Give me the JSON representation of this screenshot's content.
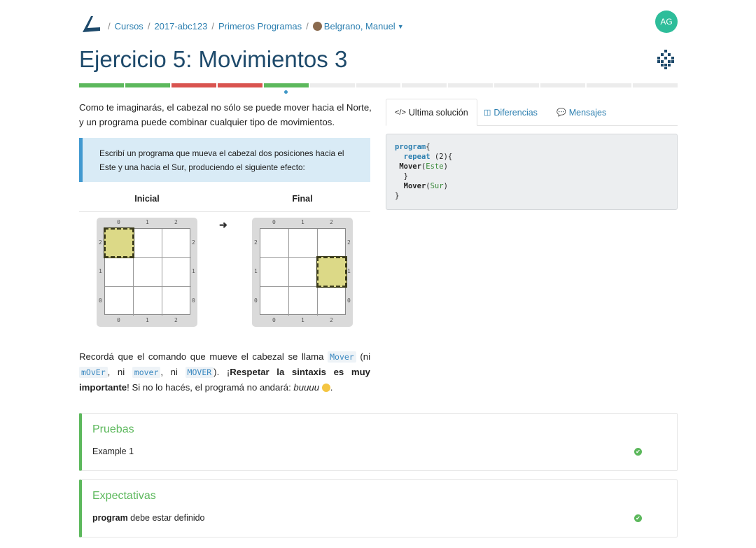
{
  "header": {
    "breadcrumb": [
      {
        "label": "Cursos"
      },
      {
        "label": "2017-abc123"
      },
      {
        "label": "Primeros Programas"
      },
      {
        "label": "Belgrano, Manuel"
      }
    ],
    "user_initials": "AG"
  },
  "exercise": {
    "title": "Ejercicio 5: Movimientos 3",
    "progress": [
      {
        "state": "passed",
        "color": "#5cb85c"
      },
      {
        "state": "passed",
        "color": "#5cb85c"
      },
      {
        "state": "failed",
        "color": "#d9534f"
      },
      {
        "state": "failed",
        "color": "#d9534f"
      },
      {
        "state": "passed",
        "color": "#5cb85c"
      },
      {
        "state": "pending",
        "color": "#ececec"
      },
      {
        "state": "pending",
        "color": "#ececec"
      },
      {
        "state": "pending",
        "color": "#ececec"
      },
      {
        "state": "pending",
        "color": "#ececec"
      },
      {
        "state": "pending",
        "color": "#ececec"
      },
      {
        "state": "pending",
        "color": "#ececec"
      },
      {
        "state": "pending",
        "color": "#ececec"
      },
      {
        "state": "pending",
        "color": "#ececec"
      }
    ],
    "current_index": 5
  },
  "content": {
    "intro": "Como te imaginarás, el cabezal no sólo se puede mover hacia el Norte, y un programa puede combinar cualquier tipo de movimientos.",
    "task": "Escribí un programa que mueva el cabezal dos posiciones hacia el Este y una hacia el Sur, produciendo el siguiente efecto:",
    "board_initial_label": "Inicial",
    "board_final_label": "Final",
    "coords": [
      "0",
      "1",
      "2"
    ],
    "note_1": "Recordá que el comando que mueve el cabezal se llama",
    "code_mover": "Mover",
    "note_2": "(ni",
    "code_mover2": "mOvEr",
    "note_3": ",",
    "note_4": "ni",
    "code_mover3": "mover",
    "note_5": ", ni",
    "code_mover4": "MOVER",
    "note_6": "). ¡",
    "note_bold": "Respetar la sintaxis es muy importante",
    "note_7": "! Si no lo hacés, el programá no andará:",
    "note_italic": "buuuu",
    "note_8": "."
  },
  "tabs": [
    {
      "label": "Ultima solución",
      "icon": "code-icon",
      "glyph": "</>"
    },
    {
      "label": "Diferencias",
      "icon": "columns-icon",
      "glyph": "◫"
    },
    {
      "label": "Mensajes",
      "icon": "chat-icon",
      "glyph": "💬"
    }
  ],
  "solution": {
    "program": "program",
    "repeat": "repeat",
    "count": "2",
    "mover": "Mover",
    "este": "Este",
    "sur": "Sur"
  },
  "results": {
    "tests_title": "Pruebas",
    "tests": [
      {
        "label": "Example 1",
        "status": "passed"
      }
    ],
    "expectations_title": "Expectativas",
    "expectations": [
      {
        "bold": "program",
        "text": " debe estar definido",
        "status": "passed"
      }
    ]
  }
}
